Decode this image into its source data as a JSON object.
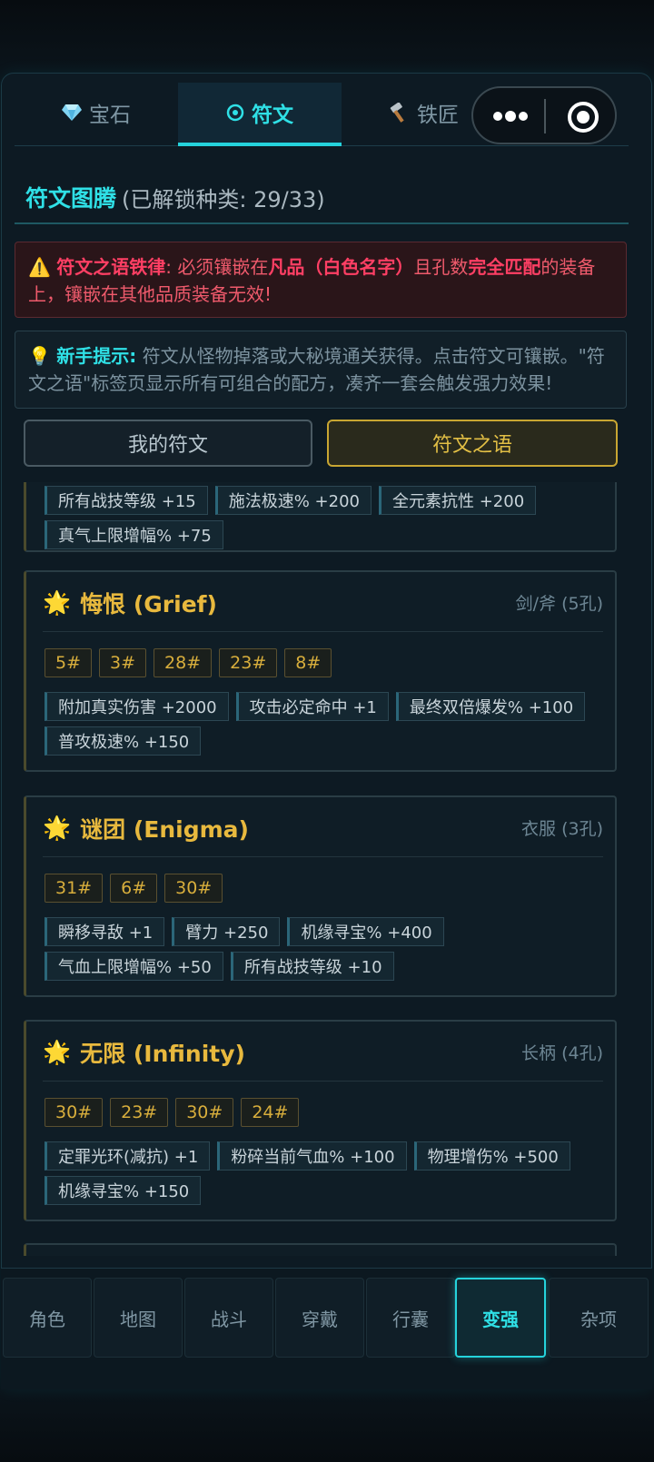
{
  "tabs": [
    {
      "label": "宝石",
      "icon": "gem-icon"
    },
    {
      "label": "符文",
      "icon": "rune-icon"
    },
    {
      "label": "铁匠",
      "icon": "hammer-icon"
    }
  ],
  "section": {
    "title": "符文图腾",
    "subtitle": "(已解锁种类: 29/33)"
  },
  "warning": {
    "icon": "⚠️",
    "lead": "符文之语铁律",
    "text1": ": 必须镶嵌在",
    "em1": "凡品（白色名字）",
    "text2": "且孔数",
    "em2": "完全匹配",
    "text3": "的装备上，镶嵌在其他品质装备无效!"
  },
  "tip": {
    "icon": "💡",
    "lead": "新手提示:",
    "text": " 符文从怪物掉落或大秘境通关获得。点击符文可镶嵌。\"符文之语\"标签页显示所有可组合的配方，凑齐一套会触发强力效果!"
  },
  "buttons": {
    "mine": "我的符文",
    "words": "符文之语"
  },
  "partial_card": {
    "effects": [
      "所有战技等级 +15",
      "施法极速% +200",
      "全元素抗性 +200",
      "真气上限增幅% +75"
    ]
  },
  "cards": [
    {
      "name": "悔恨 (Grief)",
      "type": "剑/斧 (5孔)",
      "runes": [
        "5#",
        "3#",
        "28#",
        "23#",
        "8#"
      ],
      "effects": [
        "附加真实伤害 +2000",
        "攻击必定命中 +1",
        "最终双倍爆发% +100",
        "普攻极速% +150"
      ]
    },
    {
      "name": "谜团 (Enigma)",
      "type": "衣服 (3孔)",
      "runes": [
        "31#",
        "6#",
        "30#"
      ],
      "effects": [
        "瞬移寻敌 +1",
        "臂力 +250",
        "机缘寻宝% +400",
        "气血上限增幅% +50",
        "所有战技等级 +10"
      ]
    },
    {
      "name": "无限 (Infinity)",
      "type": "长柄 (4孔)",
      "runes": [
        "30#",
        "23#",
        "30#",
        "24#"
      ],
      "effects": [
        "定罪光环(减抗) +1",
        "粉碎当前气血% +100",
        "物理增伤% +500",
        "机缘寻宝% +150"
      ]
    }
  ],
  "nav": [
    "角色",
    "地图",
    "战斗",
    "穿戴",
    "行囊",
    "变强",
    "杂项"
  ],
  "active_nav": "变强",
  "colors": {
    "accent": "#2fe0e6",
    "gold": "#e8b93e",
    "danger": "#ff3f64"
  }
}
